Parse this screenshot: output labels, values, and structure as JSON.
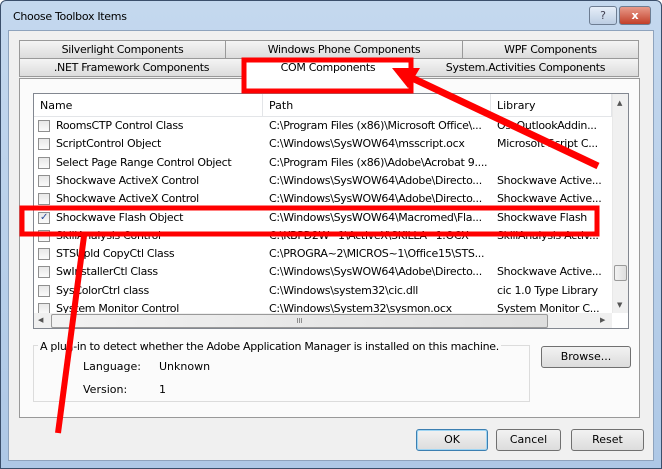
{
  "window": {
    "title": "Choose Toolbox Items",
    "help_label": "?",
    "close_label": "x"
  },
  "tabs": {
    "row1": [
      "Silverlight Components",
      "Windows Phone Components",
      "WPF Components"
    ],
    "row2": [
      ".NET Framework Components",
      "COM Components",
      "System.Activities Components"
    ],
    "selected": "COM Components"
  },
  "list": {
    "columns": [
      "Name",
      "Path",
      "Library"
    ],
    "rows": [
      {
        "checked": false,
        "name": "RoomsCTP Control Class",
        "path": "C:\\Program Files (x86)\\Microsoft Office\\...",
        "library": "OscOutlookAddin..."
      },
      {
        "checked": false,
        "name": "ScriptControl Object",
        "path": "C:\\Windows\\SysWOW64\\msscript.ocx",
        "library": "Microsoft Script C..."
      },
      {
        "checked": false,
        "name": "Select Page Range Control Object",
        "path": "C:\\Program Files (x86)\\Adobe\\Acrobat 9....",
        "library": ""
      },
      {
        "checked": false,
        "name": "Shockwave ActiveX Control",
        "path": "C:\\Windows\\SysWOW64\\Adobe\\Directo...",
        "library": "Shockwave Active..."
      },
      {
        "checked": false,
        "name": "Shockwave ActiveX Control",
        "path": "C:\\Windows\\SysWOW64\\Adobe\\Directo...",
        "library": "Shockwave Active..."
      },
      {
        "checked": true,
        "name": "Shockwave Flash Object",
        "path": "C:\\Windows\\SysWOW64\\Macromed\\Fla...",
        "library": "Shockwave Flash"
      },
      {
        "checked": false,
        "name": "SkillAnalysis Control",
        "path": "C:\\KBPD2W~1\\ActiveX\\SKILLA~1.OCX",
        "library": "SkillAnalysis Activ..."
      },
      {
        "checked": false,
        "name": "STSUpld CopyCtl Class",
        "path": "C:\\PROGRA~2\\MICROS~1\\Office15\\STS...",
        "library": ""
      },
      {
        "checked": false,
        "name": "SwInstallerCtl Class",
        "path": "C:\\Windows\\SysWOW64\\Adobe\\Directo...",
        "library": "Shockwave Active..."
      },
      {
        "checked": false,
        "name": "SysColorCtrl class",
        "path": "C:\\Windows\\system32\\cic.dll",
        "library": "cic 1.0 Type Library"
      },
      {
        "checked": false,
        "name": "System Monitor Control",
        "path": "C:\\Windows\\System32\\sysmon.ocx",
        "library": "System Monitor C..."
      }
    ],
    "hscroll_grip": "III"
  },
  "details": {
    "description": "A plug-in to detect whether the Adobe Application Manager is installed on this machine.",
    "language_label": "Language:",
    "language_value": "Unknown",
    "version_label": "Version:",
    "version_value": "1"
  },
  "buttons": {
    "browse": "Browse...",
    "ok": "OK",
    "cancel": "Cancel",
    "reset": "Reset"
  },
  "colors": {
    "annotation": "#ff0000"
  }
}
